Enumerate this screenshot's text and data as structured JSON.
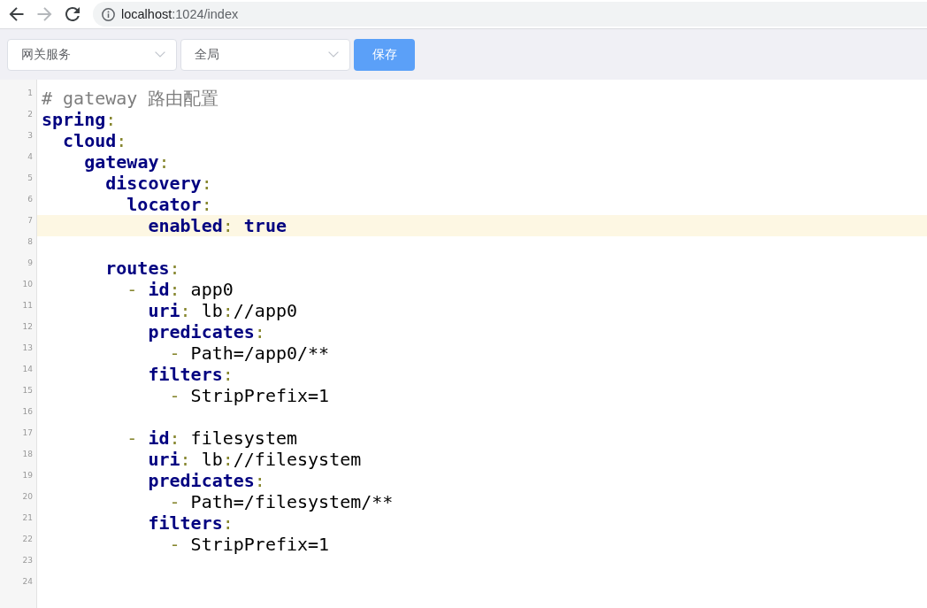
{
  "browser": {
    "nav": [
      {
        "kind": "back",
        "disabled": false
      },
      {
        "kind": "forward",
        "disabled": true
      },
      {
        "kind": "reload",
        "disabled": false
      }
    ],
    "address": {
      "host": "localhost",
      "path": ":1024/index"
    }
  },
  "toolbar": {
    "selects": [
      {
        "value": "网关服务"
      },
      {
        "value": "全局"
      }
    ],
    "save_button": "保存"
  },
  "editor": {
    "lines": [
      {
        "number": "1",
        "active": false,
        "tokens": [
          {
            "kind": "comment",
            "text": "# gateway 路由配置"
          }
        ]
      },
      {
        "number": "2",
        "active": false,
        "tokens": [
          {
            "kind": "key",
            "text": "spring"
          },
          {
            "kind": "punct",
            "text": ":"
          }
        ]
      },
      {
        "number": "3",
        "active": false,
        "tokens": [
          {
            "kind": "key",
            "text": "  cloud"
          },
          {
            "kind": "punct",
            "text": ":"
          }
        ]
      },
      {
        "number": "4",
        "active": false,
        "tokens": [
          {
            "kind": "key",
            "text": "    gateway"
          },
          {
            "kind": "punct",
            "text": ":"
          }
        ]
      },
      {
        "number": "5",
        "active": false,
        "tokens": [
          {
            "kind": "key",
            "text": "      discovery"
          },
          {
            "kind": "punct",
            "text": ":"
          }
        ]
      },
      {
        "number": "6",
        "active": false,
        "tokens": [
          {
            "kind": "key",
            "text": "        locator"
          },
          {
            "kind": "punct",
            "text": ":"
          }
        ]
      },
      {
        "number": "7",
        "active": true,
        "tokens": [
          {
            "kind": "key",
            "text": "          enabled"
          },
          {
            "kind": "punct",
            "text": ":"
          },
          {
            "kind": "atom",
            "text": " true"
          }
        ]
      },
      {
        "number": "8",
        "active": false
      },
      {
        "number": "9",
        "active": false,
        "tokens": [
          {
            "kind": "key",
            "text": "      routes"
          },
          {
            "kind": "punct",
            "text": ":"
          }
        ]
      },
      {
        "number": "10",
        "active": false,
        "tokens": [
          {
            "kind": "punct",
            "text": "        -"
          },
          {
            "kind": "key",
            "text": " id"
          },
          {
            "kind": "punct",
            "text": ":"
          },
          {
            "kind": "plain",
            "text": " app0"
          }
        ]
      },
      {
        "number": "11",
        "active": false,
        "tokens": [
          {
            "kind": "key",
            "text": "          uri"
          },
          {
            "kind": "punct",
            "text": ":"
          },
          {
            "kind": "plain",
            "text": " lb"
          },
          {
            "kind": "punct",
            "text": ":"
          },
          {
            "kind": "plain",
            "text": "//app0"
          }
        ]
      },
      {
        "number": "12",
        "active": false,
        "tokens": [
          {
            "kind": "key",
            "text": "          predicates"
          },
          {
            "kind": "punct",
            "text": ":"
          }
        ]
      },
      {
        "number": "13",
        "active": false,
        "tokens": [
          {
            "kind": "punct",
            "text": "            -"
          },
          {
            "kind": "plain",
            "text": " Path=/app0/**"
          }
        ]
      },
      {
        "number": "14",
        "active": false,
        "tokens": [
          {
            "kind": "key",
            "text": "          filters"
          },
          {
            "kind": "punct",
            "text": ":"
          }
        ]
      },
      {
        "number": "15",
        "active": false,
        "tokens": [
          {
            "kind": "punct",
            "text": "            -"
          },
          {
            "kind": "plain",
            "text": " StripPrefix=1"
          }
        ]
      },
      {
        "number": "16",
        "active": false
      },
      {
        "number": "17",
        "active": false,
        "tokens": [
          {
            "kind": "punct",
            "text": "        -"
          },
          {
            "kind": "key",
            "text": " id"
          },
          {
            "kind": "punct",
            "text": ":"
          },
          {
            "kind": "plain",
            "text": " filesystem"
          }
        ]
      },
      {
        "number": "18",
        "active": false,
        "tokens": [
          {
            "kind": "key",
            "text": "          uri"
          },
          {
            "kind": "punct",
            "text": ":"
          },
          {
            "kind": "plain",
            "text": " lb"
          },
          {
            "kind": "punct",
            "text": ":"
          },
          {
            "kind": "plain",
            "text": "//filesystem"
          }
        ]
      },
      {
        "number": "19",
        "active": false,
        "tokens": [
          {
            "kind": "key",
            "text": "          predicates"
          },
          {
            "kind": "punct",
            "text": ":"
          }
        ]
      },
      {
        "number": "20",
        "active": false,
        "tokens": [
          {
            "kind": "punct",
            "text": "            -"
          },
          {
            "kind": "plain",
            "text": " Path=/filesystem/**"
          }
        ]
      },
      {
        "number": "21",
        "active": false,
        "tokens": [
          {
            "kind": "key",
            "text": "          filters"
          },
          {
            "kind": "punct",
            "text": ":"
          }
        ]
      },
      {
        "number": "22",
        "active": false,
        "tokens": [
          {
            "kind": "punct",
            "text": "            -"
          },
          {
            "kind": "plain",
            "text": " StripPrefix=1"
          }
        ]
      },
      {
        "number": "23",
        "active": false
      },
      {
        "number": "24",
        "active": false
      }
    ]
  }
}
